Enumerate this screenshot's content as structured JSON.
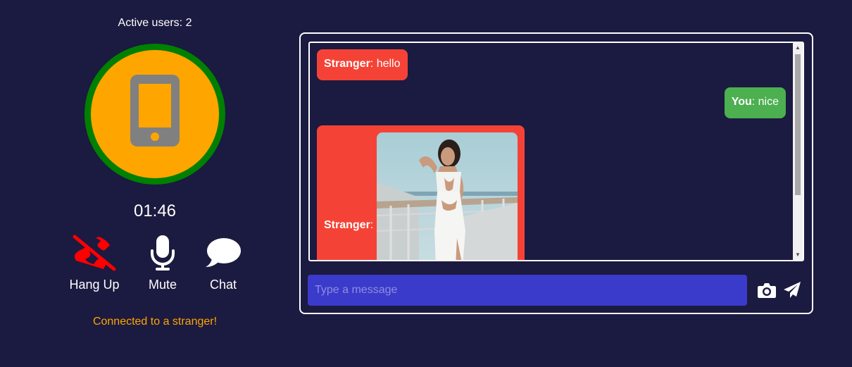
{
  "header": {
    "active_users": "Active users: 2"
  },
  "call": {
    "timer": "01:46",
    "status": "Connected to a stranger!",
    "avatar_icon": "mobile-phone-icon",
    "colors": {
      "ring": "#008000",
      "fill": "#ffa500",
      "status_text": "#ffa500"
    }
  },
  "controls": {
    "hangup": {
      "label": "Hang Up",
      "icon": "phone-slash-icon",
      "color": "#ff0000"
    },
    "mute": {
      "label": "Mute",
      "icon": "microphone-icon"
    },
    "chat": {
      "label": "Chat",
      "icon": "speech-bubble-icon"
    }
  },
  "chat": {
    "messages": [
      {
        "sender": "Stranger",
        "separator": ": ",
        "text": "hello",
        "color": "#f44336"
      },
      {
        "sender": "You",
        "separator": ": ",
        "text": "nice",
        "color": "#4caf50"
      },
      {
        "sender": "Stranger",
        "separator": ":",
        "text": "",
        "attachment": "photo",
        "color": "#f44336"
      }
    ],
    "input": {
      "placeholder": "Type a message",
      "value": ""
    },
    "camera_icon": "camera-icon",
    "send_icon": "paper-plane-icon",
    "input_color": "#3a3acb"
  }
}
